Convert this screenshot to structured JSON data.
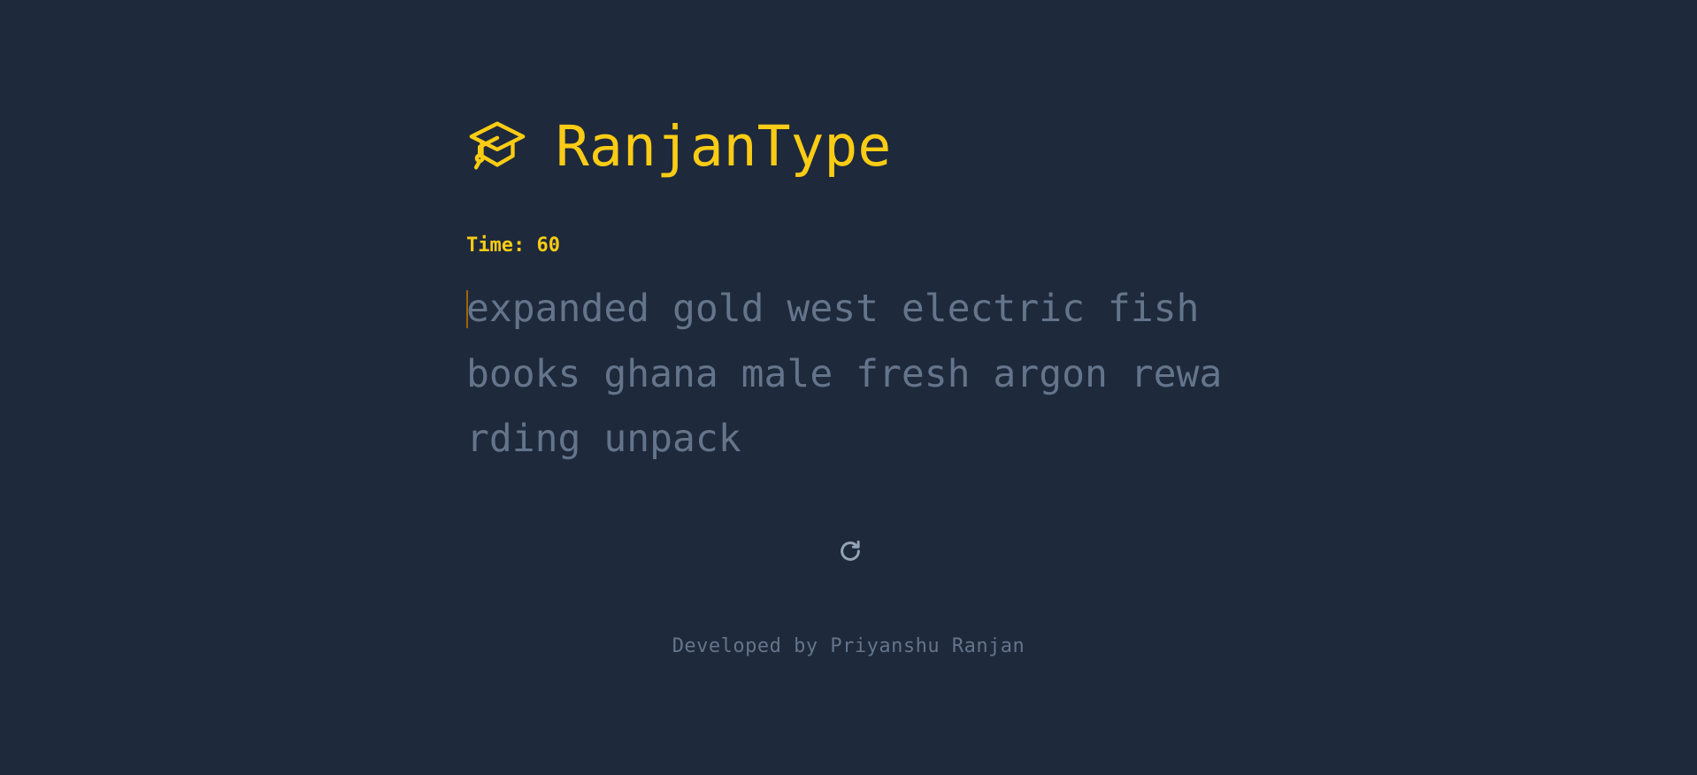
{
  "app": {
    "title": "RanjanType",
    "logo_icon": "graduation-cap-icon",
    "accent_color": "#facc15",
    "background_color": "#1e293b"
  },
  "timer": {
    "label": "Time:",
    "value": "60"
  },
  "test": {
    "text": "expanded gold west electric fish books ghana male fresh argon rewarding unpack",
    "text_color": "#64748b",
    "caret_color": "#a16207"
  },
  "controls": {
    "restart_icon": "restart-icon"
  },
  "footer": {
    "credit": "Developed by Priyanshu Ranjan"
  }
}
